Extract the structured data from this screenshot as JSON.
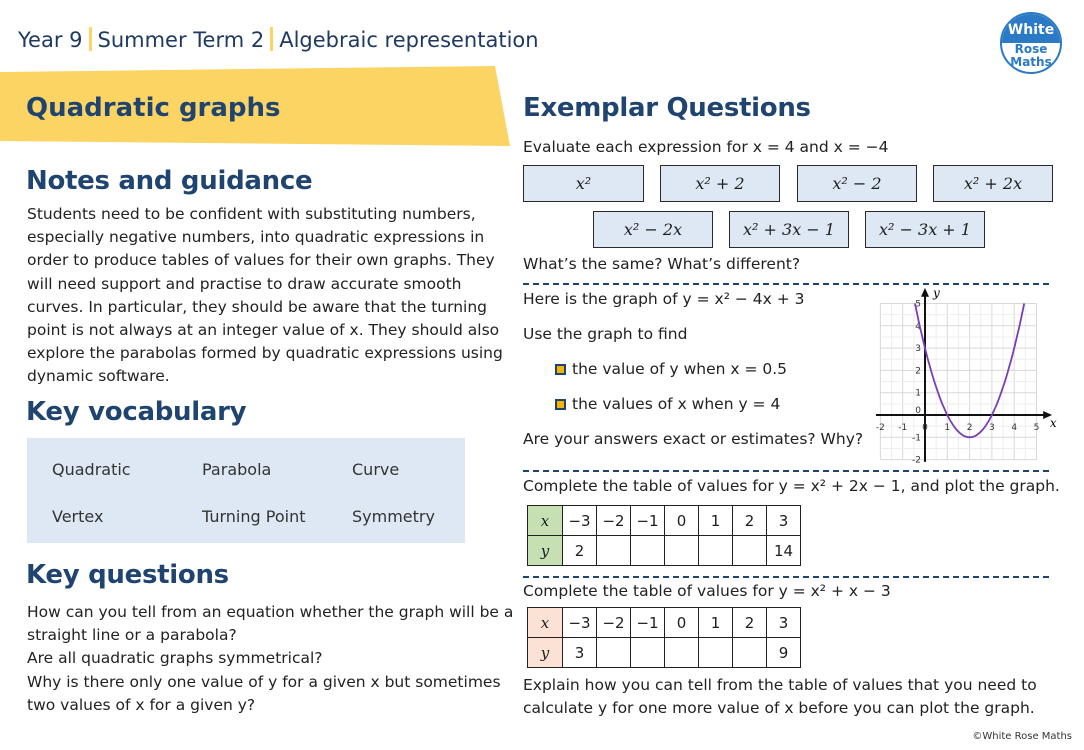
{
  "header": {
    "year": "Year 9",
    "term": "Summer Term 2",
    "unit": "Algebraic representation",
    "logo": {
      "line1": "White",
      "line2": "Rose",
      "line3": "Maths"
    }
  },
  "colors": {
    "navy": "#1f4470",
    "yellow": "#fbd464",
    "light_blue": "#dde8f4",
    "green": "#c6e0b4",
    "peach": "#fbe2d5",
    "curve": "#7a3fb0"
  },
  "title": "Quadratic graphs",
  "notes": {
    "heading": "Notes and guidance",
    "lines": [
      "Students need to be confident with substituting numbers,",
      "especially negative numbers, into quadratic expressions in",
      "order to produce tables of values for their own graphs. They",
      "will need support and practise to draw accurate smooth",
      "curves. In particular, they should be aware that the turning",
      "point is not always at an integer value of x. They should also",
      "explore the parabolas formed by quadratic expressions using",
      "dynamic software."
    ]
  },
  "vocab": {
    "heading": "Key vocabulary",
    "words": [
      "Quadratic",
      "Parabola",
      "Curve",
      "Vertex",
      "Turning Point",
      "Symmetry"
    ]
  },
  "questions": {
    "heading": "Key questions",
    "lines": [
      "How can you tell from an equation whether the graph will be a",
      "straight line or a parabola?",
      "Are all quadratic graphs symmetrical?",
      "Why is there only one value of y for a given x but sometimes",
      "two values of x for a given y?"
    ]
  },
  "exemplar": {
    "heading": "Exemplar Questions",
    "q1": {
      "prompt": "Evaluate each expression for x = 4 and x = −4",
      "expressions": [
        "x²",
        "x² + 2",
        "x² − 2",
        "x² + 2x",
        "x² − 2x",
        "x² + 3x − 1",
        "x² − 3x + 1"
      ],
      "follow": "What’s the same? What’s different?"
    },
    "q2": {
      "prompt": "Here is the graph of y = x² − 4x + 3",
      "use": "Use the graph to find",
      "bullets": [
        "the value of y when x = 0.5",
        "the values of x when y = 4"
      ],
      "follow": "Are your answers exact or estimates? Why?"
    },
    "graph": {
      "equation": "y = x² − 4x + 3",
      "xlim": [
        -2,
        5
      ],
      "ylim": [
        -2,
        5
      ],
      "x_ticks": [
        "-2",
        "-1",
        "0",
        "1",
        "2",
        "3",
        "4",
        "5"
      ],
      "y_ticks": [
        "-2",
        "-1",
        "0",
        "1",
        "2",
        "3",
        "4",
        "5"
      ],
      "xlabel": "x",
      "ylabel": "y",
      "grid": true
    },
    "q3": {
      "prompt": "Complete the table of values for y = x² + 2x − 1, and plot the graph.",
      "x_label": "x",
      "y_label": "y",
      "x": [
        "−3",
        "−2",
        "−1",
        "0",
        "1",
        "2",
        "3"
      ],
      "y": [
        "2",
        "",
        "",
        "",
        "",
        "",
        "14"
      ]
    },
    "q4": {
      "prompt": "Complete the table of values for y = x² + x − 3",
      "x_label": "x",
      "y_label": "y",
      "x": [
        "−3",
        "−2",
        "−1",
        "0",
        "1",
        "2",
        "3"
      ],
      "y": [
        "3",
        "",
        "",
        "",
        "",
        "",
        "9"
      ],
      "explain": [
        "Explain how you can tell from the table of values that you need to",
        "calculate y for one more value of x before you can plot the graph."
      ]
    }
  },
  "copyright": "©White Rose Maths"
}
